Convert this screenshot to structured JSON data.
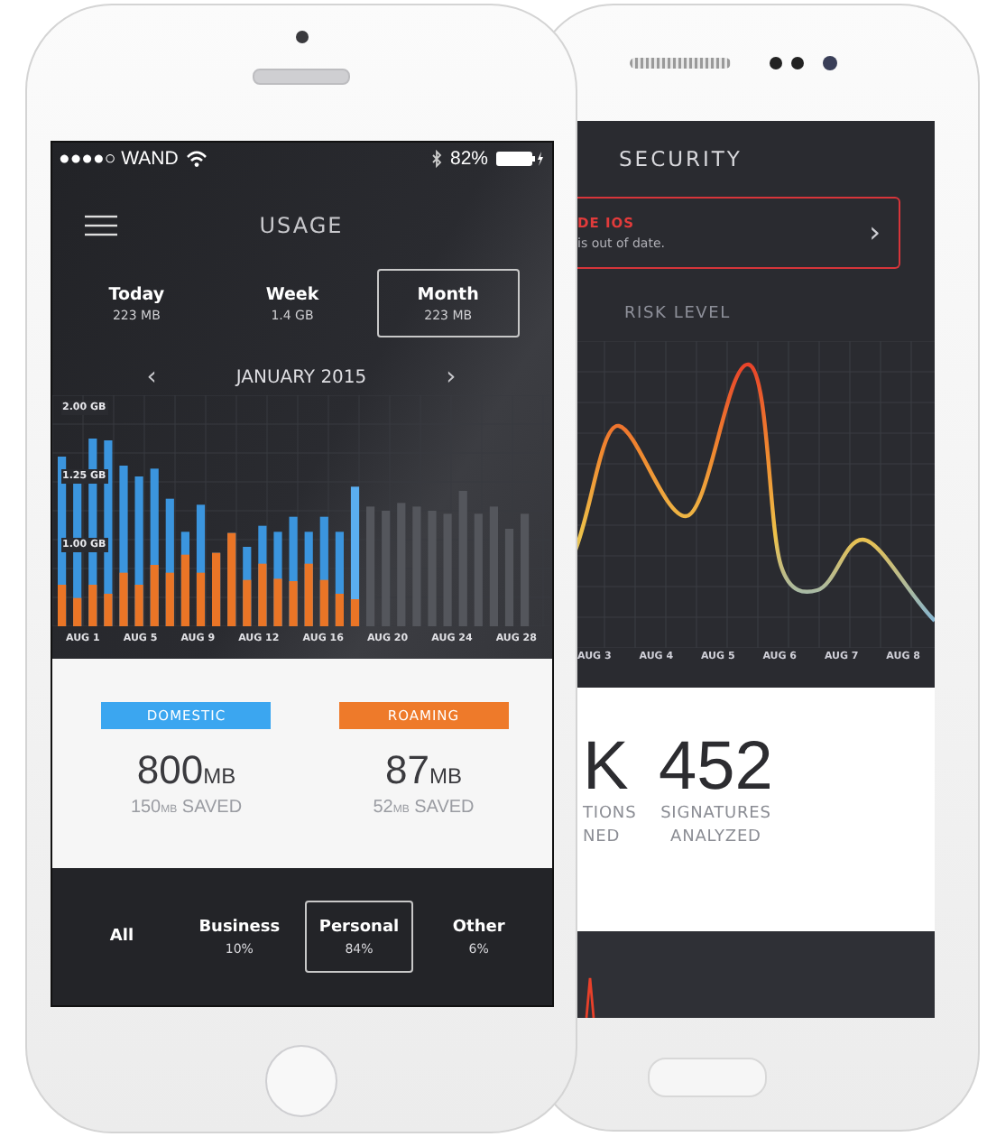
{
  "usage_phone": {
    "status_bar": {
      "carrier": "●●●●○ WAND",
      "battery": "82%"
    },
    "header": {
      "title": "USAGE"
    },
    "periods": [
      {
        "label": "Today",
        "amount": "223 MB",
        "selected": false
      },
      {
        "label": "Week",
        "amount": "1.4 GB",
        "selected": false
      },
      {
        "label": "Month",
        "amount": "223 MB",
        "selected": true
      }
    ],
    "month_nav": {
      "prev": "‹",
      "month": "JANUARY 2015",
      "next": "›"
    },
    "chart": {
      "y_labels": [
        "2.00 GB",
        "1.25 GB",
        "1.00 GB"
      ],
      "x_labels": [
        "AUG 1",
        "AUG 5",
        "AUG 9",
        "AUG 12",
        "AUG 16",
        "AUG 20",
        "AUG 24",
        "AUG 28"
      ]
    },
    "summary": [
      {
        "label": "DOMESTIC",
        "color": "#3ba6f0",
        "value": "800",
        "unit": "MB",
        "saved_value": "150",
        "saved_unit": "MB",
        "saved_label": "SAVED"
      },
      {
        "label": "ROAMING",
        "color": "#ee7a2a",
        "value": "87",
        "unit": "MB",
        "saved_value": "52",
        "saved_unit": "MB",
        "saved_label": "SAVED"
      }
    ],
    "filters": [
      {
        "label": "All",
        "selected": false
      },
      {
        "label": "Business",
        "share": "10%",
        "selected": false
      },
      {
        "label": "Personal",
        "share": "84%",
        "selected": true
      },
      {
        "label": "Other",
        "share": "6%",
        "selected": false
      }
    ]
  },
  "security_phone": {
    "title": "SECURITY",
    "alert": {
      "title": "DE IOS",
      "message": "is out of date.",
      "chevron": "›"
    },
    "risk_chart": {
      "title": "RISK LEVEL",
      "x_labels": [
        "AUG 3",
        "AUG 4",
        "AUG 5",
        "AUG 6",
        "AUG 7",
        "AUG 8"
      ]
    },
    "stats": [
      {
        "value": "K",
        "label_lines": [
          "TIONS",
          "NED"
        ]
      },
      {
        "value": "452",
        "label_lines": [
          "SIGNATURES",
          "ANALYZED"
        ]
      }
    ]
  }
}
